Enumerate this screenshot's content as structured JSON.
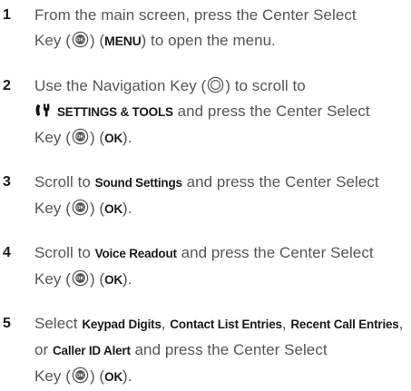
{
  "steps": [
    {
      "number": "1",
      "line1": "From the main screen, press the Center Select",
      "line2_a": "Key (",
      "line2_b": ") (",
      "line2_kw": "MENU",
      "line2_c": ") to open the menu."
    },
    {
      "number": "2",
      "line1_a": "Use the Navigation Key (",
      "line1_b": ") to scroll to",
      "line2_kw": "SETTINGS & TOOLS",
      "line2_c": " and press the Center Select",
      "line3_a": "Key (",
      "line3_b": ") (",
      "line3_kw": "OK",
      "line3_c": ")."
    },
    {
      "number": "3",
      "line1_a": "Scroll to ",
      "line1_kw": "Sound Settings",
      "line1_c": " and press the Center Select",
      "line2_a": "Key (",
      "line2_b": ") (",
      "line2_kw": "OK",
      "line2_c": ")."
    },
    {
      "number": "4",
      "line1_a": "Scroll to ",
      "line1_kw": "Voice Readout",
      "line1_c": " and press the Center Select",
      "line2_a": "Key (",
      "line2_b": ") (",
      "line2_kw": "OK",
      "line2_c": ")."
    },
    {
      "number": "5",
      "line1_a": "Select ",
      "line1_kw1": "Keypad Digits",
      "line1_sep1": ", ",
      "line1_kw2": "Contact List Entries",
      "line1_sep2": ", ",
      "line1_kw3": "Recent Call Entries",
      "line1_sep3": ",",
      "line2_a": "or ",
      "line2_kw": "Caller ID Alert",
      "line2_c": " and press the Center Select",
      "line3_a": "Key (",
      "line3_b": ") (",
      "line3_kw": "OK",
      "line3_c": ")."
    }
  ],
  "icons": {
    "center_select": "ok-key-icon",
    "navigation": "navigation-key-icon",
    "settings_tools": "settings-tools-icon"
  }
}
